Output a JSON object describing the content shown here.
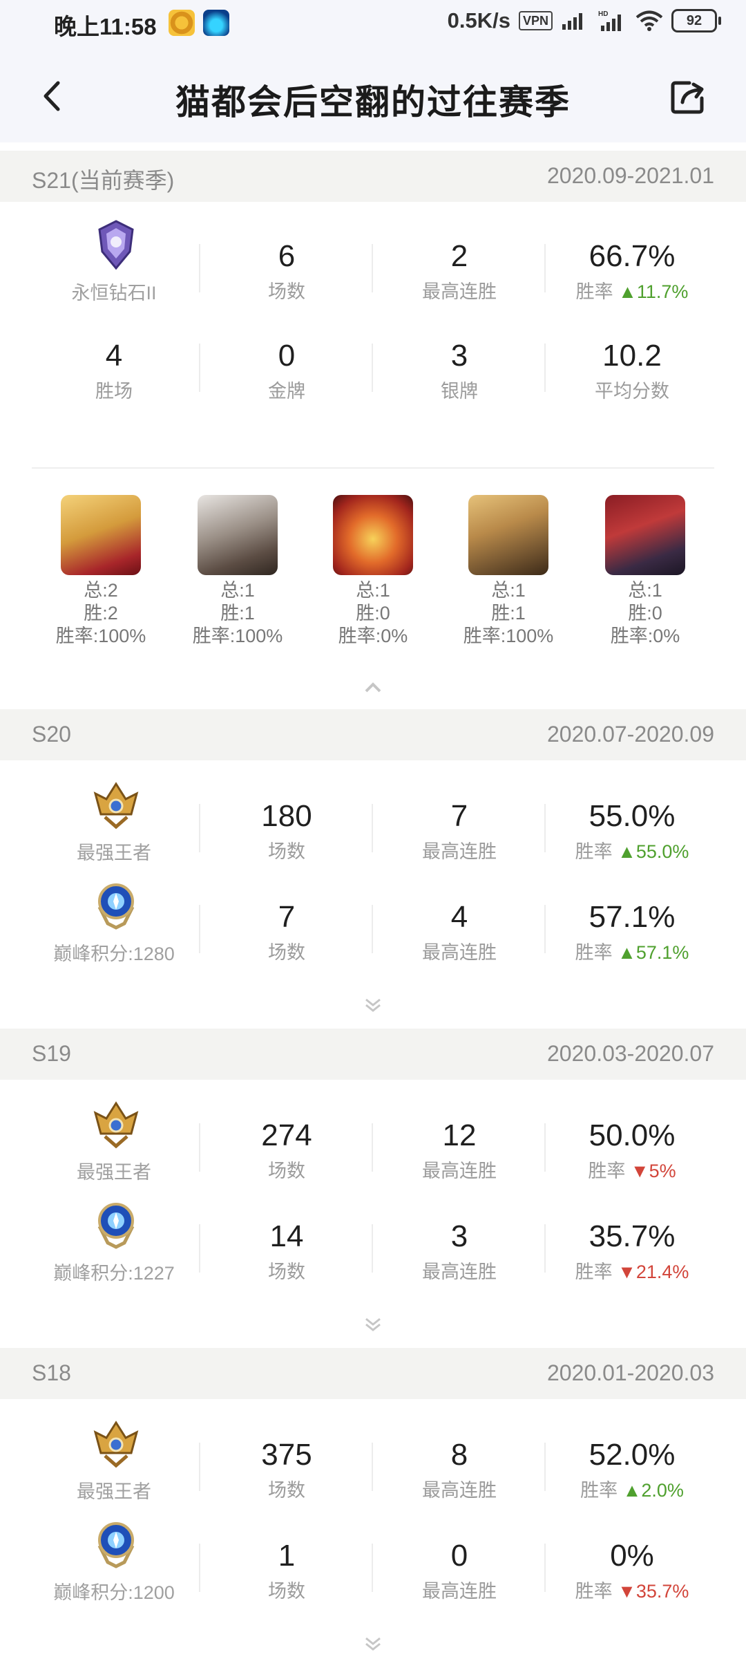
{
  "status": {
    "time": "晚上11:58",
    "speed": "0.5K/s",
    "vpn": "VPN",
    "battery": "92",
    "network": "HD"
  },
  "header": {
    "title": "猫都会后空翻的过往赛季"
  },
  "seasons": [
    {
      "name": "S21(当前赛季)",
      "range": "2020.09-2021.01",
      "rows": [
        {
          "rank_label": "永恒钻石II",
          "games": "6",
          "games_label": "场数",
          "streak": "2",
          "streak_label": "最高连胜",
          "winrate": "66.7%",
          "winrate_label": "胜率",
          "delta": "11.7%",
          "delta_dir": "up"
        }
      ],
      "stats": [
        {
          "value": "4",
          "label": "胜场"
        },
        {
          "value": "0",
          "label": "金牌"
        },
        {
          "value": "3",
          "label": "银牌"
        },
        {
          "value": "10.2",
          "label": "平均分数"
        }
      ],
      "heroes": [
        {
          "total": "总:2",
          "wins": "胜:2",
          "rate": "胜率:100%"
        },
        {
          "total": "总:1",
          "wins": "胜:1",
          "rate": "胜率:100%"
        },
        {
          "total": "总:1",
          "wins": "胜:0",
          "rate": "胜率:0%"
        },
        {
          "total": "总:1",
          "wins": "胜:1",
          "rate": "胜率:100%"
        },
        {
          "total": "总:1",
          "wins": "胜:0",
          "rate": "胜率:0%"
        }
      ]
    },
    {
      "name": "S20",
      "range": "2020.07-2020.09",
      "rows": [
        {
          "rank_label": "最强王者",
          "games": "180",
          "games_label": "场数",
          "streak": "7",
          "streak_label": "最高连胜",
          "winrate": "55.0%",
          "winrate_label": "胜率",
          "delta": "55.0%",
          "delta_dir": "up"
        },
        {
          "rank_label": "巅峰积分:1280",
          "games": "7",
          "games_label": "场数",
          "streak": "4",
          "streak_label": "最高连胜",
          "winrate": "57.1%",
          "winrate_label": "胜率",
          "delta": "57.1%",
          "delta_dir": "up"
        }
      ]
    },
    {
      "name": "S19",
      "range": "2020.03-2020.07",
      "rows": [
        {
          "rank_label": "最强王者",
          "games": "274",
          "games_label": "场数",
          "streak": "12",
          "streak_label": "最高连胜",
          "winrate": "50.0%",
          "winrate_label": "胜率",
          "delta": "5%",
          "delta_dir": "down"
        },
        {
          "rank_label": "巅峰积分:1227",
          "games": "14",
          "games_label": "场数",
          "streak": "3",
          "streak_label": "最高连胜",
          "winrate": "35.7%",
          "winrate_label": "胜率",
          "delta": "21.4%",
          "delta_dir": "down"
        }
      ]
    },
    {
      "name": "S18",
      "range": "2020.01-2020.03",
      "rows": [
        {
          "rank_label": "最强王者",
          "games": "375",
          "games_label": "场数",
          "streak": "8",
          "streak_label": "最高连胜",
          "winrate": "52.0%",
          "winrate_label": "胜率",
          "delta": "2.0%",
          "delta_dir": "up"
        },
        {
          "rank_label": "巅峰积分:1200",
          "games": "1",
          "games_label": "场数",
          "streak": "0",
          "streak_label": "最高连胜",
          "winrate": "0%",
          "winrate_label": "胜率",
          "delta": "35.7%",
          "delta_dir": "down"
        }
      ]
    }
  ],
  "colors": {
    "up": "#4fa02e",
    "down": "#d2453a",
    "section_bg": "#f3f3f1",
    "header_bg": "#f5f6fb"
  }
}
